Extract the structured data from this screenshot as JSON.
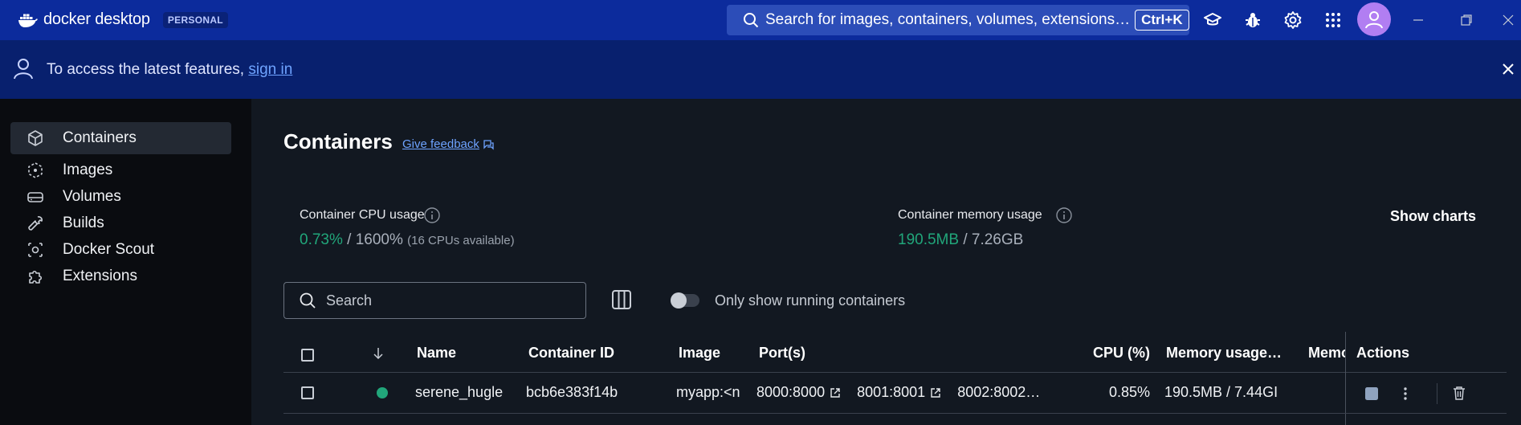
{
  "titlebar": {
    "brand_light": "docker",
    "brand_bold": "desktop",
    "plan_badge": "PERSONAL",
    "search_placeholder": "Search for images, containers, volumes, extensions…",
    "search_shortcut": "Ctrl+K",
    "icons": [
      "learning-center-icon",
      "troubleshoot-bug-icon",
      "settings-gear-icon",
      "extensions-grid-icon",
      "account-avatar-icon"
    ],
    "accent_color": "#0c2b9c"
  },
  "banner": {
    "text": "To access the latest features, ",
    "link": "sign in"
  },
  "sidebar": {
    "items": [
      {
        "label": "Containers",
        "icon": "container-cube-icon",
        "active": true
      },
      {
        "label": "Images",
        "icon": "image-layers-icon",
        "active": false
      },
      {
        "label": "Volumes",
        "icon": "volume-drive-icon",
        "active": false
      },
      {
        "label": "Builds",
        "icon": "build-wrench-icon",
        "active": false
      },
      {
        "label": "Docker Scout",
        "icon": "scout-icon",
        "active": false
      },
      {
        "label": "Extensions",
        "icon": "puzzle-icon",
        "active": false
      }
    ]
  },
  "main": {
    "title": "Containers",
    "feedback": "Give feedback",
    "cpu": {
      "label": "Container CPU usage",
      "value": "0.73%",
      "sep": " / ",
      "total": "1600%",
      "note": "(16 CPUs available)"
    },
    "memory": {
      "label": "Container memory usage",
      "value": "190.5MB",
      "sep": " / ",
      "total": "7.26GB"
    },
    "show_charts": "Show charts",
    "search_placeholder": "Search",
    "toggle_label": "Only show running containers",
    "columns": [
      "Name",
      "Container ID",
      "Image",
      "Port(s)",
      "CPU (%)",
      "Memory usage…",
      "Memo",
      "Actions"
    ],
    "rows": [
      {
        "status": "running",
        "name": "serene_hugle",
        "container_id": "bcb6e383f14b",
        "image": "myapp:<no",
        "ports": [
          "8000:8000",
          "8001:8001",
          "8002:8002…"
        ],
        "cpu": "0.85%",
        "memory": "190.5MB / 7.44GI"
      }
    ],
    "status_color": "#21a67a"
  }
}
